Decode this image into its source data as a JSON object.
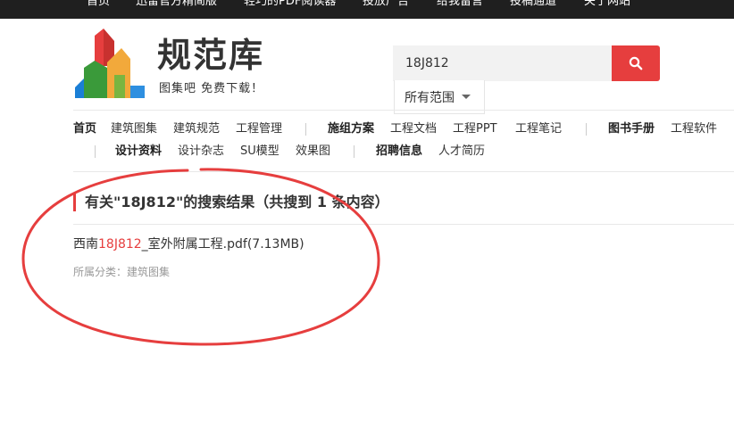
{
  "topnav": {
    "items": [
      "首页",
      "迅雷官方精简版",
      "轻巧的PDF阅读器",
      "投放广告",
      "给我留言",
      "投稿通道",
      "关于网站"
    ]
  },
  "logo": {
    "title": "规范库",
    "slogan": "图集吧 免费下载！"
  },
  "search": {
    "value": "18J812",
    "scope": "所有范围"
  },
  "nav": {
    "row1": [
      {
        "label": "首页",
        "bold": true
      },
      {
        "label": "建筑图集",
        "bold": false
      },
      {
        "label": "建筑规范",
        "bold": false
      },
      {
        "label": "工程管理",
        "bold": false
      },
      {
        "label": "施组方案",
        "bold": true
      },
      {
        "label": "工程文档",
        "bold": false
      },
      {
        "label": "工程PPT",
        "bold": false
      },
      {
        "label": "工程笔记",
        "bold": false
      },
      {
        "label": "图书手册",
        "bold": true
      },
      {
        "label": "工程软件",
        "bold": false
      }
    ],
    "row2": [
      {
        "label": "设计资料",
        "bold": true
      },
      {
        "label": "设计杂志",
        "bold": false
      },
      {
        "label": "SU模型",
        "bold": false
      },
      {
        "label": "效果图",
        "bold": false
      },
      {
        "label": "招聘信息",
        "bold": true
      },
      {
        "label": "人才简历",
        "bold": false
      }
    ]
  },
  "results": {
    "heading": "有关\"18J812\"的搜索结果（共搜到 1 条内容）",
    "items": [
      {
        "prefix": "西南",
        "highlight": "18J812",
        "suffix": "_室外附属工程.pdf(7.13MB)",
        "category": "所属分类：建筑图集"
      }
    ]
  },
  "colors": {
    "accent": "#e63e3e",
    "topbar": "#1f1f1f"
  }
}
